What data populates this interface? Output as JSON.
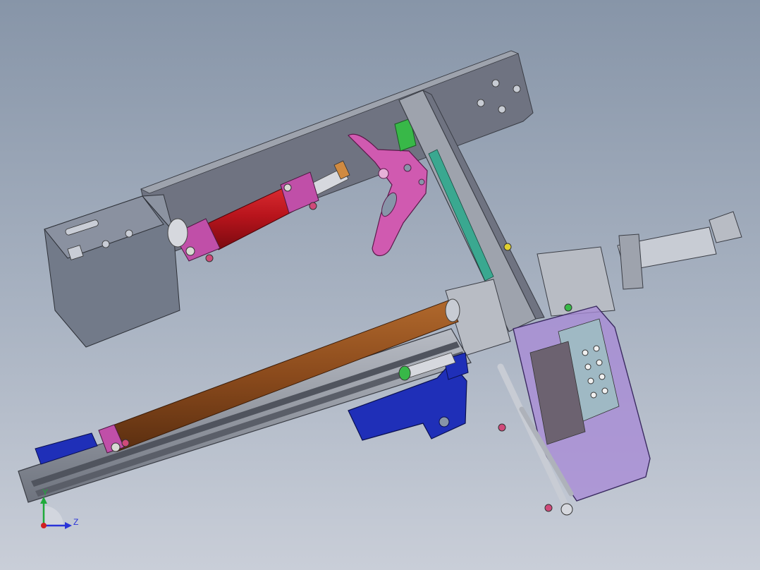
{
  "view": {
    "background_top": "#8795a8",
    "background_bottom": "#c9ced8"
  },
  "triad": {
    "y_label": "Y",
    "z_label": "Z",
    "y_color": "#1faa3a",
    "z_color": "#2a34d8",
    "x_color": "#d02020"
  },
  "colors": {
    "steel_plate": "#6f7381",
    "steel_light": "#9ea3ad",
    "control_box": "#727a89",
    "red_cylinder": "#c0151e",
    "magenta_part": "#c04fa8",
    "pink_arm": "#d05ab0",
    "brown_cylinder": "#8a4a1c",
    "blue_bracket": "#1f2fb8",
    "purple_cover": "#a88ad6",
    "green_part": "#38b848"
  }
}
